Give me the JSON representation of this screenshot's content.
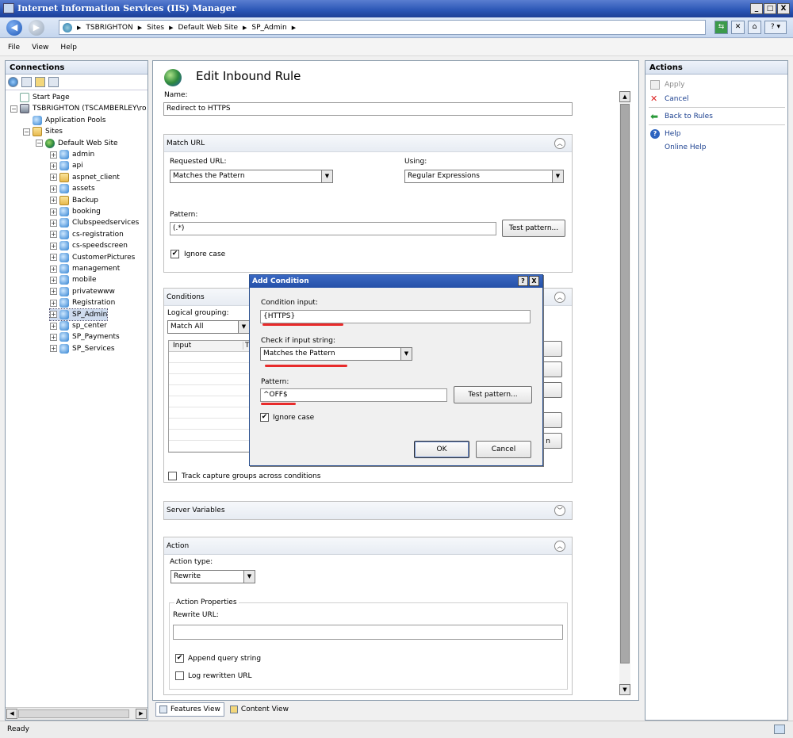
{
  "window": {
    "title": "Internet Information Services (IIS) Manager",
    "buttons": [
      "_",
      "□",
      "X"
    ]
  },
  "nav": {
    "back_icon": "back-arrow-icon",
    "forward_icon": "forward-arrow-icon",
    "breadcrumb": [
      "TSBRIGHTON",
      "Sites",
      "Default Web Site",
      "SP_Admin"
    ]
  },
  "menu": {
    "file": "File",
    "view": "View",
    "help": "Help"
  },
  "connections": {
    "title": "Connections",
    "tree": [
      {
        "label": "Start Page",
        "icon": "page-icon",
        "level": 0
      },
      {
        "label": "TSBRIGHTON (TSCAMBERLEY\\ro",
        "icon": "server-icon",
        "level": 0
      },
      {
        "label": "Application Pools",
        "icon": "app-pool-icon",
        "level": 1
      },
      {
        "label": "Sites",
        "icon": "folder-icon",
        "level": 1
      },
      {
        "label": "Default Web Site",
        "icon": "globe-icon",
        "level": 2
      },
      {
        "label": "admin",
        "icon": "app-icon",
        "level": 3
      },
      {
        "label": "api",
        "icon": "app-icon",
        "level": 3
      },
      {
        "label": "aspnet_client",
        "icon": "folder-icon",
        "level": 3
      },
      {
        "label": "assets",
        "icon": "app-icon",
        "level": 3
      },
      {
        "label": "Backup",
        "icon": "folder-icon",
        "level": 3
      },
      {
        "label": "booking",
        "icon": "app-icon",
        "level": 3
      },
      {
        "label": "Clubspeedservices",
        "icon": "app-icon",
        "level": 3
      },
      {
        "label": "cs-registration",
        "icon": "app-icon",
        "level": 3
      },
      {
        "label": "cs-speedscreen",
        "icon": "app-icon",
        "level": 3
      },
      {
        "label": "CustomerPictures",
        "icon": "app-icon",
        "level": 3
      },
      {
        "label": "management",
        "icon": "app-icon",
        "level": 3
      },
      {
        "label": "mobile",
        "icon": "app-icon",
        "level": 3
      },
      {
        "label": "privatewww",
        "icon": "app-icon",
        "level": 3
      },
      {
        "label": "Registration",
        "icon": "app-icon",
        "level": 3
      },
      {
        "label": "SP_Admin",
        "icon": "app-icon",
        "level": 3
      },
      {
        "label": "sp_center",
        "icon": "app-icon",
        "level": 3
      },
      {
        "label": "SP_Payments",
        "icon": "app-icon",
        "level": 3
      },
      {
        "label": "SP_Services",
        "icon": "app-icon",
        "level": 3
      }
    ]
  },
  "editor": {
    "title": "Edit Inbound Rule",
    "name_label": "Name:",
    "name_value": "Redirect to HTTPS",
    "match_url": {
      "heading": "Match URL",
      "requested_url_label": "Requested URL:",
      "requested_url_value": "Matches the Pattern",
      "using_label": "Using:",
      "using_value": "Regular Expressions",
      "pattern_label": "Pattern:",
      "pattern_value": "(.*)",
      "test_pattern": "Test pattern...",
      "ignore_case": "Ignore case"
    },
    "conditions": {
      "heading": "Conditions",
      "logical_grouping_label": "Logical grouping:",
      "logical_grouping_value": "Match All",
      "col_input": "Input",
      "col_type": "T",
      "track_capture": "Track capture groups across conditions",
      "partial_button_text": "n"
    },
    "server_variables": {
      "heading": "Server Variables"
    },
    "action": {
      "heading": "Action",
      "action_type_label": "Action type:",
      "action_type_value": "Rewrite",
      "properties_legend": "Action Properties",
      "rewrite_url_label": "Rewrite URL:",
      "rewrite_url_value": "",
      "append_query": "Append query string",
      "log_rewritten": "Log rewritten URL"
    }
  },
  "dialog": {
    "title": "Add Condition",
    "help_btn": "?",
    "close_btn": "X",
    "condition_input_label": "Condition input:",
    "condition_input_value": "{HTTPS}",
    "check_label": "Check if input string:",
    "check_value": "Matches the Pattern",
    "pattern_label": "Pattern:",
    "pattern_value": "^OFF$",
    "test_pattern": "Test pattern...",
    "ignore_case": "Ignore case",
    "ok": "OK",
    "cancel": "Cancel",
    "annotation_color": "#e82b2b"
  },
  "actions": {
    "title": "Actions",
    "apply": "Apply",
    "cancel": "Cancel",
    "back_to_rules": "Back to Rules",
    "help": "Help",
    "online_help": "Online Help"
  },
  "views": {
    "features": "Features View",
    "content": "Content View"
  },
  "status": {
    "text": "Ready"
  },
  "colors": {
    "title_bar": "#2a55b5",
    "link": "#1a3f8f",
    "accent_red": "#e82b2b"
  }
}
